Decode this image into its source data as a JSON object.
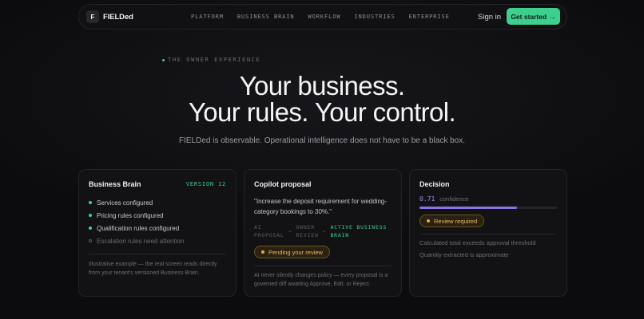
{
  "nav": {
    "logo_mark": "F",
    "brand": "FIELDed",
    "links": [
      "PLATFORM",
      "BUSINESS BRAIN",
      "WORKFLOW",
      "INDUSTRIES",
      "ENTERPRISE"
    ],
    "signin": "Sign in",
    "cta": "Get started",
    "cta_arrow": "→"
  },
  "hero": {
    "eyebrow": "THE OWNER EXPERIENCE",
    "line1": "Your business.",
    "line2": "Your rules. Your control.",
    "subtitle": "FIELDed is observable. Operational intelligence does not have to be a black box."
  },
  "business_brain": {
    "title": "Business Brain",
    "version": "VERSION 12",
    "items": [
      {
        "label": "Services configured",
        "done": true
      },
      {
        "label": "Pricing rules configured",
        "done": true
      },
      {
        "label": "Qualification rules configured",
        "done": true
      },
      {
        "label": "Escalation rules need attention",
        "done": false
      }
    ],
    "footnote": "Illustrative example — the real screen reads directly from your tenant's versioned Business Brain."
  },
  "copilot": {
    "title": "Copilot proposal",
    "quote": "\"Increase the deposit requirement for wedding-category bookings to 30%.\"",
    "flow": {
      "step1_a": "AI",
      "step1_b": "PROPOSAL",
      "step2_a": "OWNER",
      "step2_b": "REVIEW",
      "step3_a": "ACTIVE BUSINESS",
      "step3_b": "BRAIN",
      "arrow": "→"
    },
    "status": "Pending your review",
    "footnote": "AI never silently changes policy — every proposal is a governed diff awaiting Approve, Edit, or Reject."
  },
  "decision": {
    "title": "Decision",
    "confidence_value": "0.71",
    "confidence_fraction": 0.71,
    "confidence_label": "confidence",
    "status": "Review required",
    "notes": [
      "Calculated total exceeds approval threshold",
      "Quantity extracted is approximate"
    ]
  },
  "colors": {
    "accent": "#3ecf8e",
    "warning": "#e9b96a",
    "confidence": "#8a72e0"
  }
}
